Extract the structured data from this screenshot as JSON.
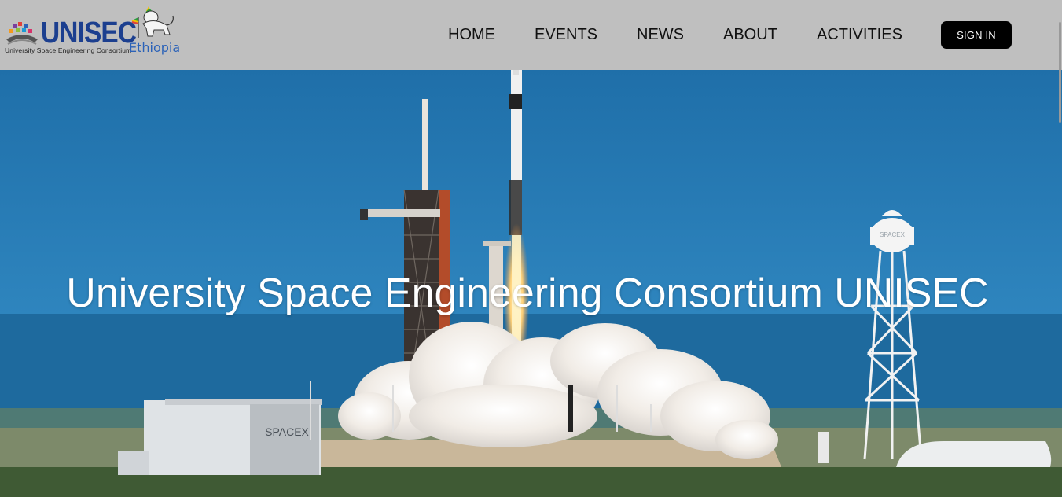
{
  "header": {
    "logo": {
      "wordmark": "UNISEC",
      "tagline": "University Space Engineering Consortium",
      "country": "Ethiopia"
    },
    "nav": [
      {
        "label": "HOME"
      },
      {
        "label": "EVENTS"
      },
      {
        "label": "NEWS"
      },
      {
        "label": "ABOUT"
      },
      {
        "label": "ACTIVITIES"
      }
    ],
    "sign_in_label": "SIGN IN"
  },
  "hero": {
    "title": "University Space Engineering Consortium UNISEC",
    "image": {
      "tower_sign": "SPACEX",
      "hangar_sign": "SPACEX"
    }
  },
  "colors": {
    "header_bg": "#bfbfbf",
    "brand_blue": "#1c3f8f",
    "sign_in_bg": "#000000",
    "sky": "#2b7fb8"
  }
}
